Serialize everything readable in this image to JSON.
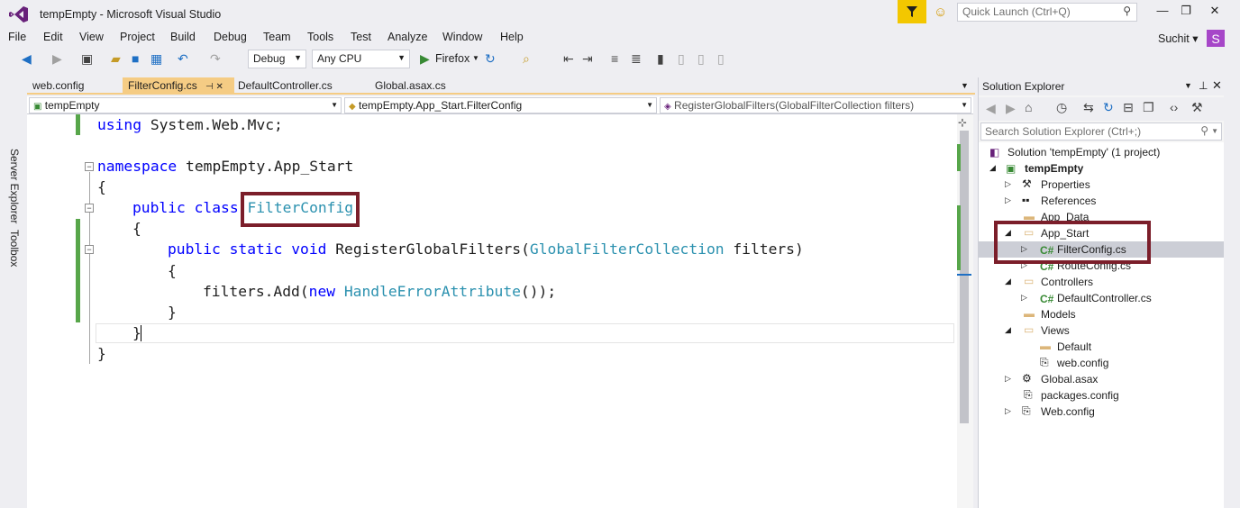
{
  "titlebar": {
    "title": "tempEmpty - Microsoft Visual Studio",
    "quick_launch_placeholder": "Quick Launch (Ctrl+Q)",
    "minimize": "—",
    "maximize": "❐",
    "close": "✕"
  },
  "menu": {
    "items": [
      "File",
      "Edit",
      "View",
      "Project",
      "Build",
      "Debug",
      "Team",
      "Tools",
      "Test",
      "Analyze",
      "Window",
      "Help"
    ],
    "user": "Suchit ▾",
    "avatar_letter": "S"
  },
  "toolbar": {
    "configuration": "Debug",
    "platform": "Any CPU",
    "start_target": "Firefox"
  },
  "side_tabs": [
    "Server Explorer",
    "Toolbox"
  ],
  "doc_tabs": [
    {
      "label": "web.config"
    },
    {
      "label": "FilterConfig.cs",
      "pin": "⊣ ✕"
    },
    {
      "label": "DefaultController.cs"
    },
    {
      "label": "Global.asax.cs"
    }
  ],
  "navbar": {
    "project": "tempEmpty",
    "type": "tempEmpty.App_Start.FilterConfig",
    "member": "RegisterGlobalFilters(GlobalFilterCollection filters)"
  },
  "code": {
    "line1_kw": "using",
    "line1_rest": " System.Web.Mvc;",
    "line3_kw": "namespace",
    "line3_rest": " tempEmpty.App_Start",
    "brace_open": "{",
    "line5_kw": "public class",
    "line5_type": "FilterConfig",
    "line7_kw": "public static void",
    "line7_name": " RegisterGlobalFilters(",
    "line7_type": "GlobalFilterCollection",
    "line7_rest": " filters)",
    "line9_pre": "filters.Add(",
    "line9_kw": "new",
    "line9_type": "HandleErrorAttribute",
    "line9_rest": "());",
    "brace_close": "}"
  },
  "solution_explorer": {
    "title": "Solution Explorer",
    "search_placeholder": "Search Solution Explorer (Ctrl+;)",
    "nodes": [
      "Solution 'tempEmpty' (1 project)",
      "tempEmpty",
      "Properties",
      "References",
      "App_Data",
      "App_Start",
      "FilterConfig.cs",
      "RouteConfig.cs",
      "Controllers",
      "DefaultController.cs",
      "Models",
      "Views",
      "Default",
      "web.config",
      "Global.asax",
      "packages.config",
      "Web.config"
    ]
  },
  "colors": {
    "highlight_box": "#7b1e2a",
    "keyword": "#0000ff",
    "type": "#2b91af",
    "active_tab": "#f5cc84"
  }
}
